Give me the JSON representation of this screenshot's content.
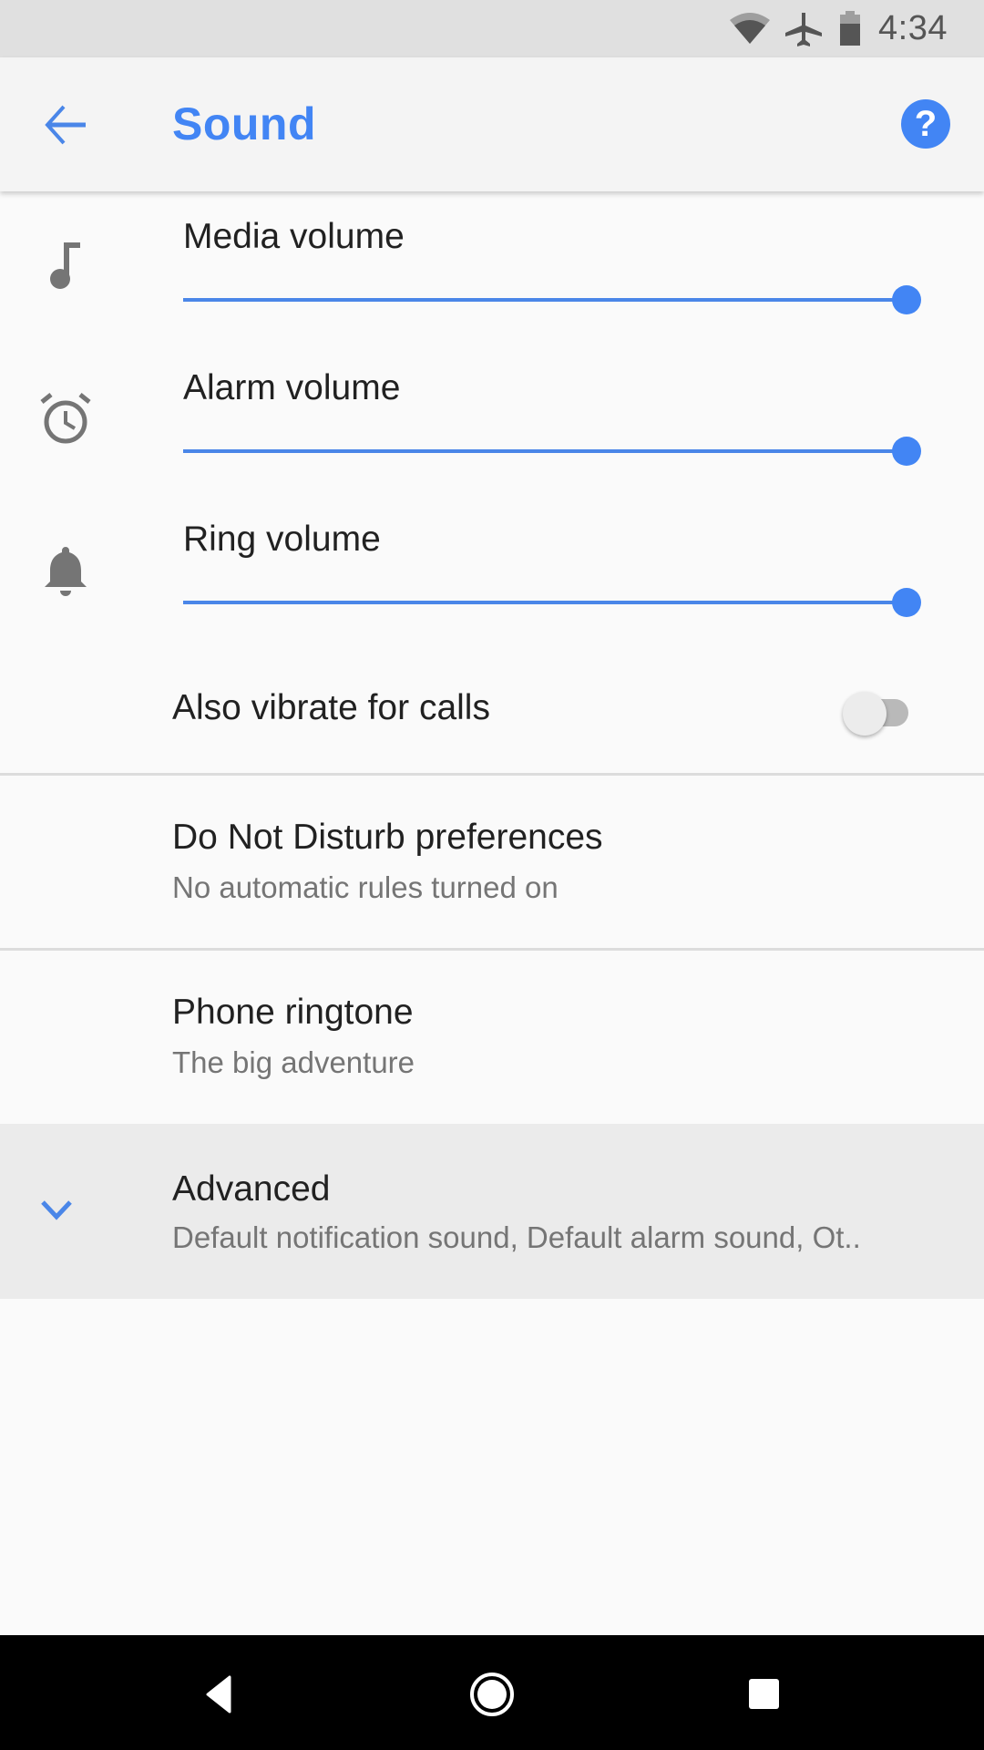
{
  "status_bar": {
    "time": "4:34",
    "icons": [
      "wifi-icon",
      "airplane-mode-icon",
      "battery-icon"
    ]
  },
  "app_bar": {
    "title": "Sound",
    "back_icon": "arrow-back-icon",
    "help_icon": "help-icon",
    "help_glyph": "?"
  },
  "volume": [
    {
      "label": "Media volume",
      "icon": "music-note-icon",
      "level_percent": 100
    },
    {
      "label": "Alarm volume",
      "icon": "alarm-clock-icon",
      "level_percent": 100
    },
    {
      "label": "Ring volume",
      "icon": "bell-icon",
      "level_percent": 100
    }
  ],
  "vibrate": {
    "label": "Also vibrate for calls",
    "checked": false
  },
  "preferences": [
    {
      "title": "Do Not Disturb preferences",
      "summary": "No automatic rules turned on"
    },
    {
      "title": "Phone ringtone",
      "summary": "The big adventure"
    }
  ],
  "advanced": {
    "title": "Advanced",
    "summary": "Default notification sound, Default alarm sound, Ot..",
    "icon": "chevron-down-icon"
  },
  "nav_bar": {
    "buttons": [
      "back",
      "home",
      "recents"
    ]
  },
  "colors": {
    "accent": "#4285f4",
    "status_bar_bg": "#e0e0e0",
    "app_bar_bg": "#f4f4f4",
    "page_bg": "#fafafa",
    "advanced_bg": "#ebebeb",
    "icon_gray": "#757575"
  }
}
